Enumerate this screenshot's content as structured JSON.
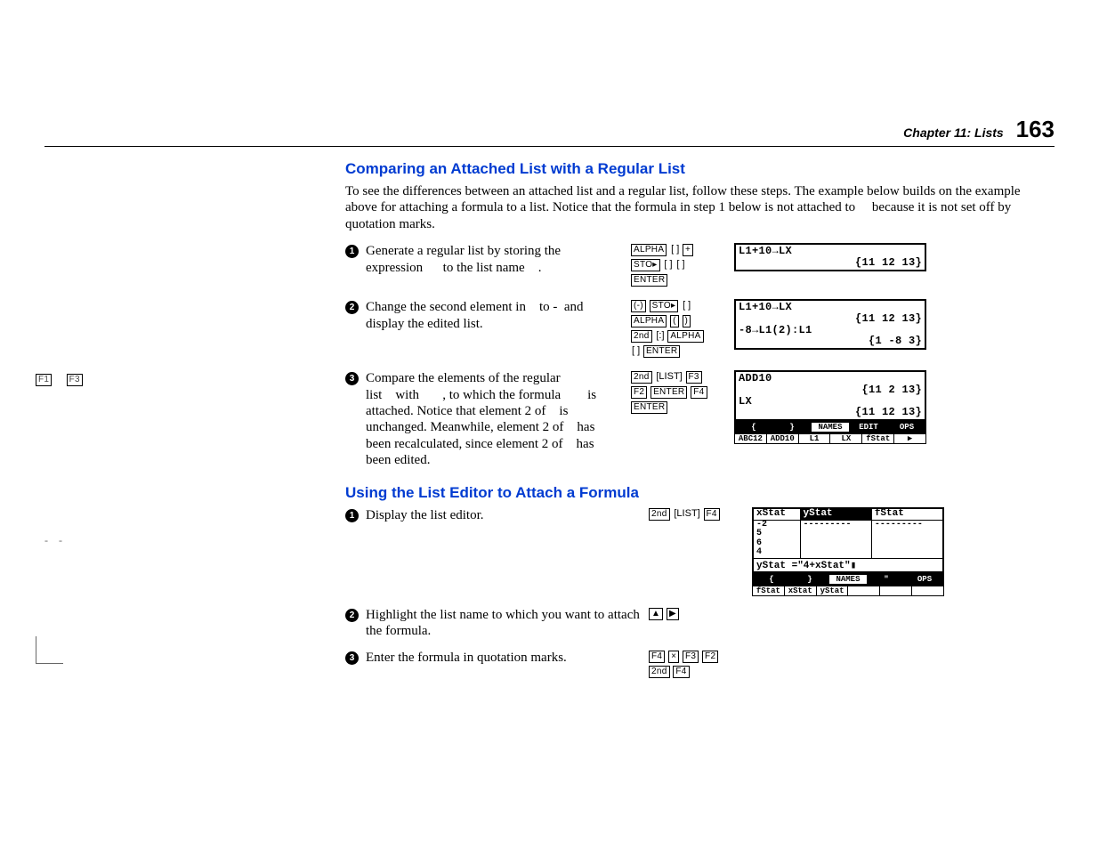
{
  "header": {
    "chapter": "Chapter 11: Lists",
    "page": "163"
  },
  "margin": {
    "keys_left": "F1",
    "keys_right": "F3",
    "dash_left": "-",
    "dash_right": "-"
  },
  "section1": {
    "title": "Comparing an Attached List with a Regular List",
    "body": "To see the differences between an attached list and a regular list, follow these steps. The example below builds on the example above for attaching a formula to a list. Notice that the formula in step 1 below is not attached to     because it is not set off by quotation marks.",
    "steps": [
      {
        "num": "1",
        "text": "Generate a regular list by storing the expression      to the list name    .",
        "keys": [
          [
            "ALPHA",
            "[ ]",
            "+"
          ],
          [
            "STO▸",
            "[ ]",
            "[ ]"
          ],
          [
            "ENTER"
          ]
        ],
        "screen": {
          "lines": [
            {
              "cls": "lt",
              "t": "L1+10→LX"
            },
            {
              "cls": "rt",
              "t": "{11 12 13}"
            }
          ]
        }
      },
      {
        "num": "2",
        "text": "Change the second element in    to ‑  and display the edited list.",
        "keys": [
          [
            "(-)",
            "STO▸",
            "[ ]"
          ],
          [
            "ALPHA",
            "(",
            ")"
          ],
          [
            "2nd",
            "[:]",
            "ALPHA"
          ],
          [
            "[ ]",
            "ENTER"
          ]
        ],
        "screen": {
          "lines": [
            {
              "cls": "lt",
              "t": "L1+10→LX"
            },
            {
              "cls": "rt",
              "t": "{11 12 13}"
            },
            {
              "cls": "lt",
              "t": "-8→L1(2):L1"
            },
            {
              "cls": "rt",
              "t": "{1 -8 3}"
            }
          ]
        }
      },
      {
        "num": "3",
        "text": "Compare the elements of the regular list    with       , to which the formula        is attached. Notice that element 2 of    is unchanged. Meanwhile, element 2 of    has been recalculated, since element 2 of    has been edited.",
        "keys": [
          [
            "2nd",
            "[LIST]",
            "F3"
          ],
          [
            "F2",
            "ENTER",
            "F4"
          ],
          [
            "ENTER"
          ]
        ],
        "screen": {
          "lines": [
            {
              "cls": "lt",
              "t": "ADD10"
            },
            {
              "cls": "rt",
              "t": "{11 2 13}"
            },
            {
              "cls": "lt",
              "t": "LX"
            },
            {
              "cls": "rt",
              "t": "{11 12 13}"
            }
          ],
          "softkeys_top": [
            "{",
            "}",
            "NAMES",
            "EDIT",
            "OPS"
          ],
          "softkeys_top_inv": [
            true,
            true,
            false,
            true,
            true
          ],
          "softkeys_bot": [
            "ABC12",
            "ADD10",
            "L1",
            "LX",
            "fStat",
            "▶"
          ]
        }
      }
    ]
  },
  "section2": {
    "title": "Using the List Editor to Attach a Formula",
    "steps": [
      {
        "num": "1",
        "text": "Display the list editor.",
        "keys": [
          [
            "2nd",
            "[LIST]",
            "F4"
          ]
        ]
      },
      {
        "num": "2",
        "text": "Highlight the list name to which you want to attach the formula.",
        "keys": [
          [
            "▲",
            "▶"
          ]
        ]
      },
      {
        "num": "3",
        "text": "Enter the formula in quotation marks.",
        "keys": [
          [
            "F4",
            "×",
            "F3",
            "F2"
          ],
          [
            "2nd",
            "F4"
          ]
        ]
      }
    ],
    "editor": {
      "cols": [
        "xStat",
        "yStat",
        "fStat"
      ],
      "col_inv": [
        false,
        true,
        false
      ],
      "rows": [
        [
          "-2",
          "---------",
          "---------"
        ],
        [
          "5",
          "",
          ""
        ],
        [
          "6",
          "",
          ""
        ],
        [
          "4",
          "",
          ""
        ]
      ],
      "formula": "yStat =\"4+xStat\"▮",
      "softkeys_top": [
        "{",
        "}",
        "NAMES",
        "\"",
        "OPS"
      ],
      "softkeys_top_inv": [
        true,
        true,
        false,
        true,
        true
      ],
      "softkeys_bot": [
        "fStat",
        "xStat",
        "yStat",
        "",
        "",
        ""
      ]
    }
  }
}
